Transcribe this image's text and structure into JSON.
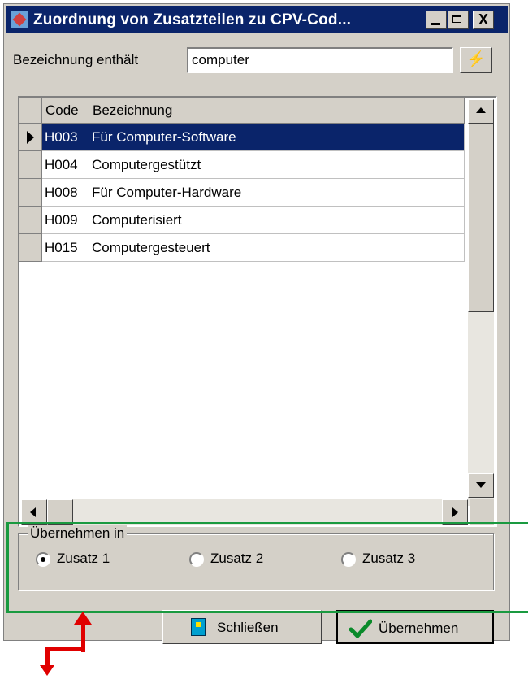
{
  "window": {
    "title": "Zuordnung von Zusatzteilen zu CPV-Cod...",
    "controls": [
      "minimize",
      "maximize",
      "close"
    ],
    "close_glyph": "X"
  },
  "filter": {
    "label": "Bezeichnung enthält",
    "value": "computer",
    "apply_icon": "lightning-icon"
  },
  "grid": {
    "columns": [
      "Code",
      "Bezeichnung"
    ],
    "rows": [
      {
        "code": "H003",
        "name": "Für Computer-Software",
        "selected": true
      },
      {
        "code": "H004",
        "name": "Computergestützt",
        "selected": false
      },
      {
        "code": "H008",
        "name": "Für Computer-Hardware",
        "selected": false
      },
      {
        "code": "H009",
        "name": "Computerisiert",
        "selected": false
      },
      {
        "code": "H015",
        "name": "Computergesteuert",
        "selected": false
      }
    ]
  },
  "target_group": {
    "legend": "Übernehmen in",
    "options": [
      "Zusatz 1",
      "Zusatz 2",
      "Zusatz 3"
    ],
    "selected": "Zusatz 1"
  },
  "buttons": {
    "close_label": "Schließen",
    "apply_label": "Übernehmen"
  },
  "colors": {
    "selection": "#0a246a",
    "annotation_frame": "#1a9a40",
    "annotation_arrow": "#e00000"
  }
}
